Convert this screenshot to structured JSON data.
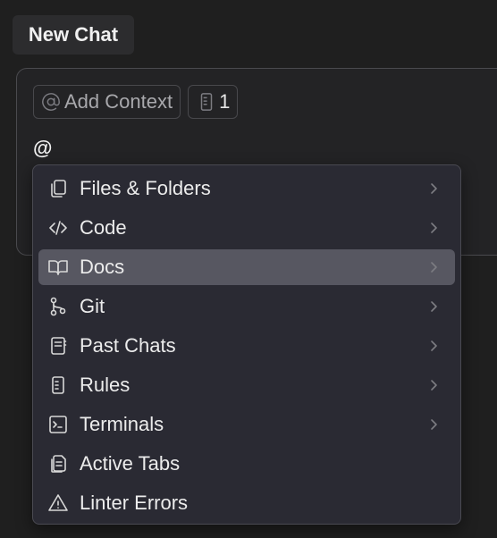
{
  "header": {
    "tab_label": "New Chat"
  },
  "composer": {
    "add_context_label": "Add Context",
    "rules_count": "1",
    "input_text": "@"
  },
  "menu": {
    "items": [
      {
        "label": "Files & Folders",
        "icon": "files-icon",
        "has_submenu": true
      },
      {
        "label": "Code",
        "icon": "code-icon",
        "has_submenu": true
      },
      {
        "label": "Docs",
        "icon": "book-icon",
        "has_submenu": true,
        "active": true
      },
      {
        "label": "Git",
        "icon": "git-branch-icon",
        "has_submenu": true
      },
      {
        "label": "Past Chats",
        "icon": "notebook-icon",
        "has_submenu": true
      },
      {
        "label": "Rules",
        "icon": "rules-icon",
        "has_submenu": true
      },
      {
        "label": "Terminals",
        "icon": "terminal-icon",
        "has_submenu": true
      },
      {
        "label": "Active Tabs",
        "icon": "tabs-icon",
        "has_submenu": false
      },
      {
        "label": "Linter Errors",
        "icon": "warning-icon",
        "has_submenu": false
      }
    ]
  },
  "colors": {
    "background": "#1f1f1f",
    "menu_background": "#2a2a33",
    "active_item": "#575761",
    "border": "#4a4a52"
  }
}
